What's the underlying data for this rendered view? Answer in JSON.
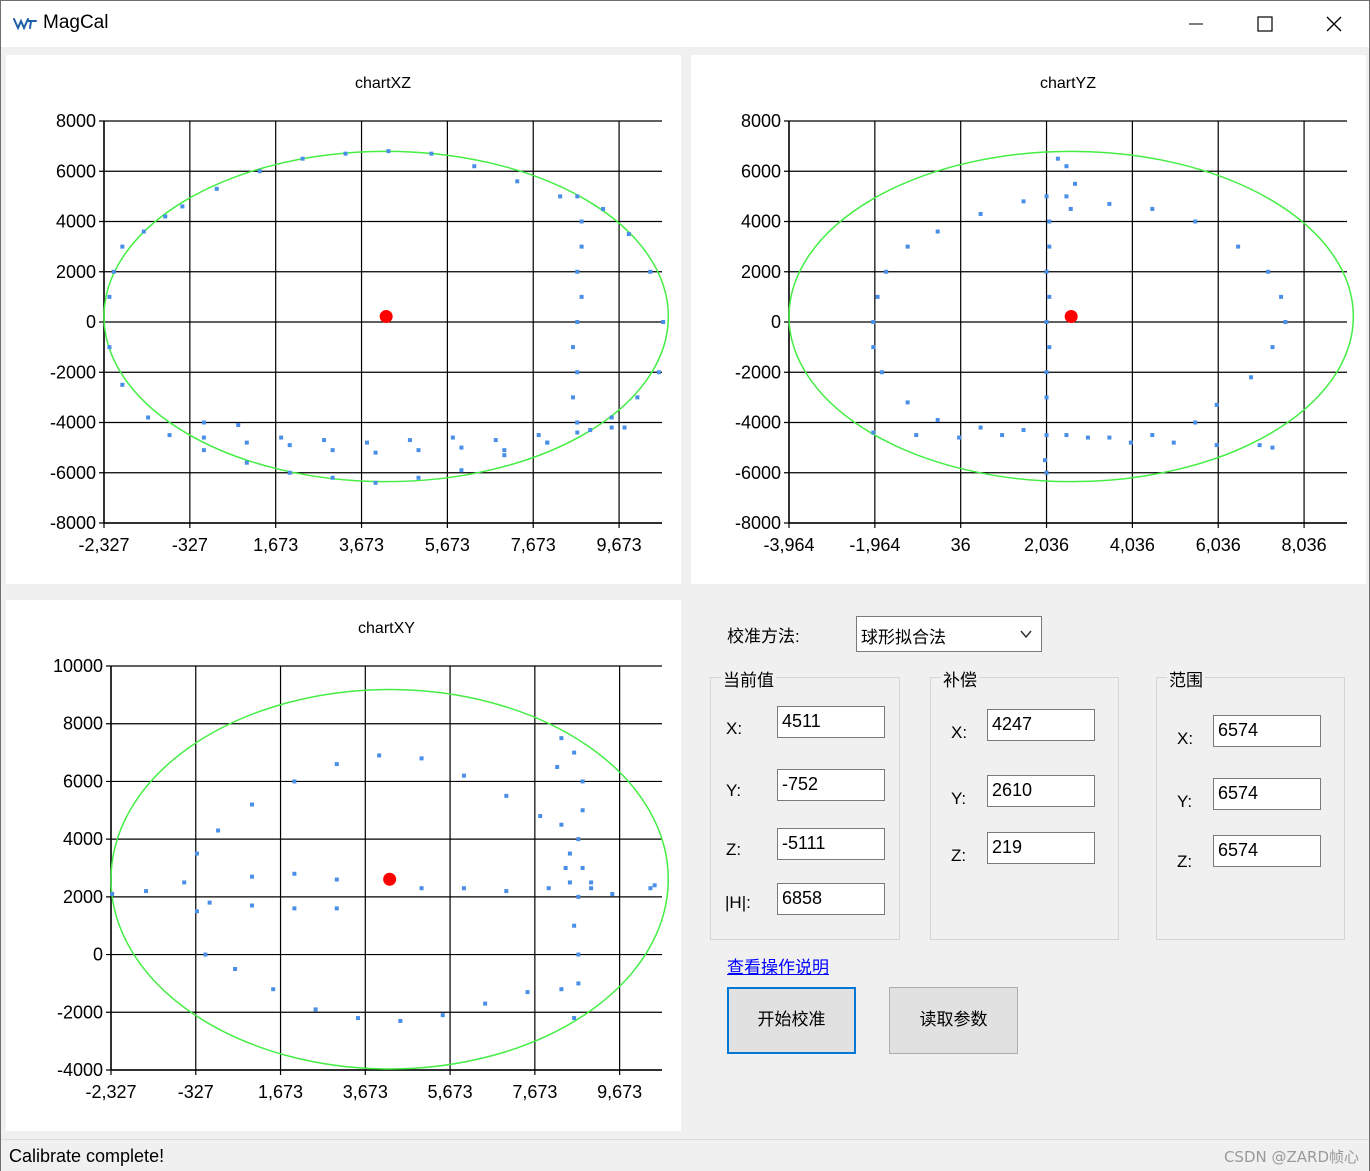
{
  "window": {
    "title": "MagCal",
    "icon": "wt-logo-icon",
    "controls": [
      "minimize-icon",
      "maximize-icon",
      "close-icon"
    ]
  },
  "colors": {
    "point": "#4a8fe7",
    "ellipse": "#44ee44",
    "center": "#ff0000",
    "link": "#0000ff",
    "accent_border": "#0078d7"
  },
  "charts": {
    "xz": {
      "title": "chartXZ",
      "x_ticks": [
        "-2,327",
        "-327",
        "1,673",
        "3,673",
        "5,673",
        "7,673",
        "9,673"
      ],
      "y_ticks": [
        "8000",
        "6000",
        "4000",
        "2000",
        "0",
        "-2000",
        "-4000",
        "-6000",
        "-8000"
      ]
    },
    "yz": {
      "title": "chartYZ",
      "x_ticks": [
        "-3,964",
        "-1,964",
        "36",
        "2,036",
        "4,036",
        "6,036",
        "8,036"
      ],
      "y_ticks": [
        "8000",
        "6000",
        "4000",
        "2000",
        "0",
        "-2000",
        "-4000",
        "-6000",
        "-8000"
      ]
    },
    "xy": {
      "title": "chartXY",
      "x_ticks": [
        "-2,327",
        "-327",
        "1,673",
        "3,673",
        "5,673",
        "7,673",
        "9,673"
      ],
      "y_ticks": [
        "10000",
        "8000",
        "6000",
        "4000",
        "2000",
        "0",
        "-2000",
        "-4000"
      ]
    }
  },
  "chart_data": [
    {
      "type": "scatter",
      "title": "chartXZ",
      "xlim": [
        -2327,
        10673
      ],
      "ylim": [
        -8000,
        8000
      ],
      "x_ticks": [
        -2327,
        -327,
        1673,
        3673,
        5673,
        7673,
        9673
      ],
      "y_ticks": [
        8000,
        6000,
        4000,
        2000,
        0,
        -2000,
        -4000,
        -6000,
        -8000
      ],
      "grid": true,
      "center": {
        "x": 4247,
        "y": 219
      },
      "fit_ellipse": {
        "cx": 4247,
        "cy": 219,
        "rx": 6574,
        "ry": 6574
      },
      "series": [
        {
          "values": [
            [
              -2200,
              1000
            ],
            [
              -2100,
              2000
            ],
            [
              -1900,
              3000
            ],
            [
              -1400,
              3600
            ],
            [
              -900,
              4200
            ],
            [
              -500,
              4600
            ],
            [
              300,
              5300
            ],
            [
              1300,
              6000
            ],
            [
              2300,
              6500
            ],
            [
              3300,
              6700
            ],
            [
              4300,
              6800
            ],
            [
              5300,
              6700
            ],
            [
              6300,
              6200
            ],
            [
              7300,
              5600
            ],
            [
              8300,
              5000
            ],
            [
              9300,
              4500
            ],
            [
              9900,
              3500
            ],
            [
              10400,
              2000
            ],
            [
              10700,
              0
            ],
            [
              10600,
              -2000
            ],
            [
              10100,
              -3000
            ],
            [
              9500,
              -3800
            ],
            [
              8700,
              -4400
            ],
            [
              8000,
              -4800
            ],
            [
              7000,
              -5300
            ],
            [
              6000,
              -5900
            ],
            [
              5000,
              -6200
            ],
            [
              4000,
              -6400
            ],
            [
              3000,
              -6200
            ],
            [
              2000,
              -6000
            ],
            [
              1000,
              -5600
            ],
            [
              0,
              -5100
            ],
            [
              -800,
              -4500
            ],
            [
              -1300,
              -3800
            ],
            [
              -1900,
              -2500
            ],
            [
              -2200,
              -1000
            ],
            [
              8700,
              5000
            ],
            [
              8800,
              4000
            ],
            [
              8800,
              3000
            ],
            [
              8700,
              2000
            ],
            [
              8800,
              1000
            ],
            [
              8700,
              0
            ],
            [
              8600,
              -1000
            ],
            [
              8700,
              -2000
            ],
            [
              8600,
              -3000
            ],
            [
              8700,
              -4000
            ],
            [
              9000,
              -4300
            ],
            [
              9500,
              -4200
            ],
            [
              9800,
              -4200
            ],
            [
              0,
              -4000
            ],
            [
              800,
              -4100
            ],
            [
              1800,
              -4600
            ],
            [
              2800,
              -4700
            ],
            [
              3800,
              -4800
            ],
            [
              4800,
              -4700
            ],
            [
              5800,
              -4600
            ],
            [
              6800,
              -4700
            ],
            [
              7800,
              -4500
            ],
            [
              0,
              -4600
            ],
            [
              1000,
              -4800
            ],
            [
              2000,
              -4900
            ],
            [
              3000,
              -5100
            ],
            [
              4000,
              -5200
            ],
            [
              5000,
              -5100
            ],
            [
              6000,
              -5000
            ],
            [
              7000,
              -5100
            ],
            [
              8000,
              -4800
            ]
          ]
        }
      ]
    },
    {
      "type": "scatter",
      "title": "chartYZ",
      "xlim": [
        -3964,
        9036
      ],
      "ylim": [
        -8000,
        8000
      ],
      "x_ticks": [
        -3964,
        -1964,
        36,
        2036,
        4036,
        6036,
        8036
      ],
      "y_ticks": [
        8000,
        6000,
        4000,
        2000,
        0,
        -2000,
        -4000,
        -6000,
        -8000
      ],
      "grid": true,
      "center": {
        "x": 2610,
        "y": 219
      },
      "fit_ellipse": {
        "cx": 2610,
        "cy": 219,
        "rx": 6574,
        "ry": 6574
      },
      "series": [
        {
          "values": [
            [
              -2000,
              0
            ],
            [
              -1900,
              1000
            ],
            [
              -1700,
              2000
            ],
            [
              -1200,
              3000
            ],
            [
              -500,
              3600
            ],
            [
              500,
              4300
            ],
            [
              1500,
              4800
            ],
            [
              2500,
              5000
            ],
            [
              3500,
              4700
            ],
            [
              4500,
              4500
            ],
            [
              5500,
              4000
            ],
            [
              6500,
              3000
            ],
            [
              7200,
              2000
            ],
            [
              7500,
              1000
            ],
            [
              7600,
              0
            ],
            [
              7300,
              -1000
            ],
            [
              6800,
              -2200
            ],
            [
              6000,
              -3300
            ],
            [
              5500,
              -4000
            ],
            [
              4500,
              -4500
            ],
            [
              3500,
              -4600
            ],
            [
              2500,
              -4500
            ],
            [
              1500,
              -4300
            ],
            [
              500,
              -4200
            ],
            [
              -500,
              -3900
            ],
            [
              -1200,
              -3200
            ],
            [
              -1800,
              -2000
            ],
            [
              -2000,
              -1000
            ],
            [
              2036,
              5000
            ],
            [
              2100,
              4000
            ],
            [
              2100,
              3000
            ],
            [
              2036,
              2000
            ],
            [
              2100,
              1000
            ],
            [
              2036,
              0
            ],
            [
              2100,
              -1000
            ],
            [
              2036,
              -2000
            ],
            [
              2036,
              -3000
            ],
            [
              2036,
              -4500
            ],
            [
              2000,
              -5500
            ],
            [
              2036,
              -6000
            ],
            [
              2300,
              6500
            ],
            [
              2500,
              6200
            ],
            [
              2700,
              5500
            ],
            [
              2600,
              4500
            ],
            [
              -2000,
              -4400
            ],
            [
              -1000,
              -4500
            ],
            [
              0,
              -4600
            ],
            [
              1000,
              -4500
            ],
            [
              3000,
              -4600
            ],
            [
              4000,
              -4800
            ],
            [
              5000,
              -4800
            ],
            [
              6000,
              -4900
            ],
            [
              7000,
              -4900
            ],
            [
              7300,
              -5000
            ]
          ]
        }
      ]
    },
    {
      "type": "scatter",
      "title": "chartXY",
      "xlim": [
        -2327,
        10673
      ],
      "ylim": [
        -4000,
        10000
      ],
      "x_ticks": [
        -2327,
        -327,
        1673,
        3673,
        5673,
        7673,
        9673
      ],
      "y_ticks": [
        10000,
        8000,
        6000,
        4000,
        2000,
        0,
        -2000,
        -4000
      ],
      "grid": true,
      "center": {
        "x": 4247,
        "y": 2610
      },
      "fit_ellipse": {
        "cx": 4247,
        "cy": 2610,
        "rx": 6574,
        "ry": 6574
      },
      "series": [
        {
          "values": [
            [
              -2300,
              2100
            ],
            [
              -1500,
              2200
            ],
            [
              -600,
              2500
            ],
            [
              -300,
              3500
            ],
            [
              200,
              4300
            ],
            [
              1000,
              5200
            ],
            [
              2000,
              6000
            ],
            [
              3000,
              6600
            ],
            [
              4000,
              6900
            ],
            [
              5000,
              6800
            ],
            [
              6000,
              6200
            ],
            [
              7000,
              5500
            ],
            [
              7800,
              4800
            ],
            [
              8500,
              3500
            ],
            [
              9000,
              2500
            ],
            [
              9500,
              2100
            ],
            [
              10400,
              2300
            ],
            [
              10500,
              2400
            ],
            [
              -300,
              1500
            ],
            [
              -100,
              0
            ],
            [
              600,
              -500
            ],
            [
              1500,
              -1200
            ],
            [
              2500,
              -1900
            ],
            [
              3500,
              -2200
            ],
            [
              4500,
              -2300
            ],
            [
              5500,
              -2100
            ],
            [
              6500,
              -1700
            ],
            [
              7500,
              -1300
            ],
            [
              8300,
              -1200
            ],
            [
              8600,
              -2200
            ],
            [
              8700,
              -1000
            ],
            [
              8700,
              0
            ],
            [
              8600,
              1000
            ],
            [
              8700,
              2000
            ],
            [
              8800,
              3000
            ],
            [
              8700,
              4000
            ],
            [
              8800,
              5000
            ],
            [
              8800,
              6000
            ],
            [
              8600,
              7000
            ],
            [
              8300,
              7500
            ],
            [
              8200,
              6500
            ],
            [
              8300,
              4500
            ],
            [
              8400,
              3000
            ],
            [
              8500,
              2500
            ],
            [
              9000,
              2300
            ],
            [
              8000,
              2300
            ],
            [
              1000,
              2700
            ],
            [
              2000,
              2800
            ],
            [
              3000,
              2600
            ],
            [
              5000,
              2300
            ],
            [
              6000,
              2300
            ],
            [
              7000,
              2200
            ],
            [
              0,
              1800
            ],
            [
              1000,
              1700
            ],
            [
              2000,
              1600
            ],
            [
              3000,
              1600
            ]
          ]
        }
      ]
    }
  ],
  "controls": {
    "method_label": "校准方法:",
    "method_value": "球形拟合法",
    "current": {
      "title": "当前值",
      "x_label": "X:",
      "x": "4511",
      "y_label": "Y:",
      "y": "-752",
      "z_label": "Z:",
      "z": "-5111",
      "h_label": "|H|:",
      "h": "6858"
    },
    "offset": {
      "title": "补偿",
      "x_label": "X:",
      "x": "4247",
      "y_label": "Y:",
      "y": "2610",
      "z_label": "Z:",
      "z": "219"
    },
    "range": {
      "title": "范围",
      "x_label": "X:",
      "x": "6574",
      "y_label": "Y:",
      "y": "6574",
      "z_label": "Z:",
      "z": "6574"
    },
    "help_link": "查看操作说明",
    "start_button": "开始校准",
    "read_button": "读取参数"
  },
  "status": {
    "text": "Calibrate complete!",
    "watermark": "CSDN @ZARD帧心"
  }
}
